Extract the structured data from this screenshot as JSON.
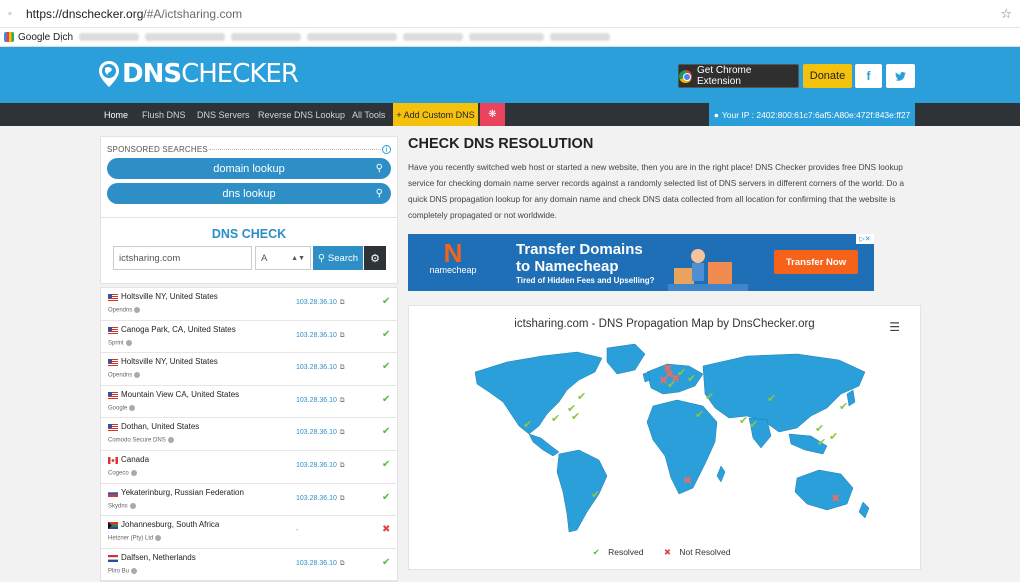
{
  "browser": {
    "url_host": "https://dnschecker.org",
    "url_rest": "/#A/ictsharing.com",
    "bookmark": "Google Dịch"
  },
  "header": {
    "logo_dns": "DNS",
    "logo_checker": "CHECKER",
    "chrome_ext": "Get Chrome Extension",
    "donate": "Donate",
    "facebook": "f",
    "twitter": "t"
  },
  "nav": {
    "items": [
      "Home",
      "Flush DNS",
      "DNS Servers",
      "Reverse DNS Lookup",
      "All Tools"
    ],
    "custom": "+ Add Custom DNS",
    "ip": "Your IP : 2402:800:61c7:6af5:A80e:472f:843e:ff27"
  },
  "sponsored": {
    "label": "SPONSORED SEARCHES",
    "pills": [
      "domain lookup",
      "dns lookup"
    ]
  },
  "dnscheck": {
    "title": "DNS CHECK",
    "domain_value": "ictsharing.com",
    "record_type": "A",
    "search_label": "Search"
  },
  "results": [
    {
      "location": "Holtsville NY, United States",
      "provider": "Opendns",
      "ip": "103.28.36.10",
      "status": "ok",
      "flag": "us"
    },
    {
      "location": "Canoga Park, CA, United States",
      "provider": "Sprint",
      "ip": "103.28.36.10",
      "status": "ok",
      "flag": "us"
    },
    {
      "location": "Holtsville NY, United States",
      "provider": "Opendns",
      "ip": "103.28.36.10",
      "status": "ok",
      "flag": "us"
    },
    {
      "location": "Mountain View CA, United States",
      "provider": "Google",
      "ip": "103.28.36.10",
      "status": "ok",
      "flag": "us"
    },
    {
      "location": "Dothan, United States",
      "provider": "Comodo Secure DNS",
      "ip": "103.28.36.10",
      "status": "ok",
      "flag": "us"
    },
    {
      "location": "Canada",
      "provider": "Cogeco",
      "ip": "103.28.36.10",
      "status": "ok",
      "flag": "ca"
    },
    {
      "location": "Yekaterinburg, Russian Federation",
      "provider": "Skydns",
      "ip": "103.28.36.10",
      "status": "ok",
      "flag": "ru"
    },
    {
      "location": "Johannesburg, South Africa",
      "provider": "Hetzner (Pty) Ltd",
      "ip": "-",
      "status": "bad",
      "flag": "za"
    },
    {
      "location": "Dalfsen, Netherlands",
      "provider": "Pliro Bu",
      "ip": "103.28.36.10",
      "status": "ok",
      "flag": "nl"
    }
  ],
  "main": {
    "title": "CHECK DNS RESOLUTION",
    "description": "Have you recently switched web host or started a new website, then you are in the right place! DNS Checker provides free DNS lookup service for checking domain name server records against a randomly selected list of DNS servers in different corners of the world. Do a quick DNS propagation lookup for any domain name and check DNS data collected from all location for confirming that the website is completely propagated or not worldwide."
  },
  "ad": {
    "brand": "namecheap",
    "line1": "Transfer Domains",
    "line2": "to Namecheap",
    "line3": "Tired of Hidden Fees and Upselling?",
    "cta": "Transfer Now"
  },
  "map": {
    "title": "ictsharing.com - DNS Propagation Map by DnsChecker.org",
    "legend_resolved": "Resolved",
    "legend_not_resolved": "Not Resolved",
    "land_color": "#2b9fd9",
    "ok_color": "#8cc63f",
    "bad_color": "#e0706a"
  }
}
